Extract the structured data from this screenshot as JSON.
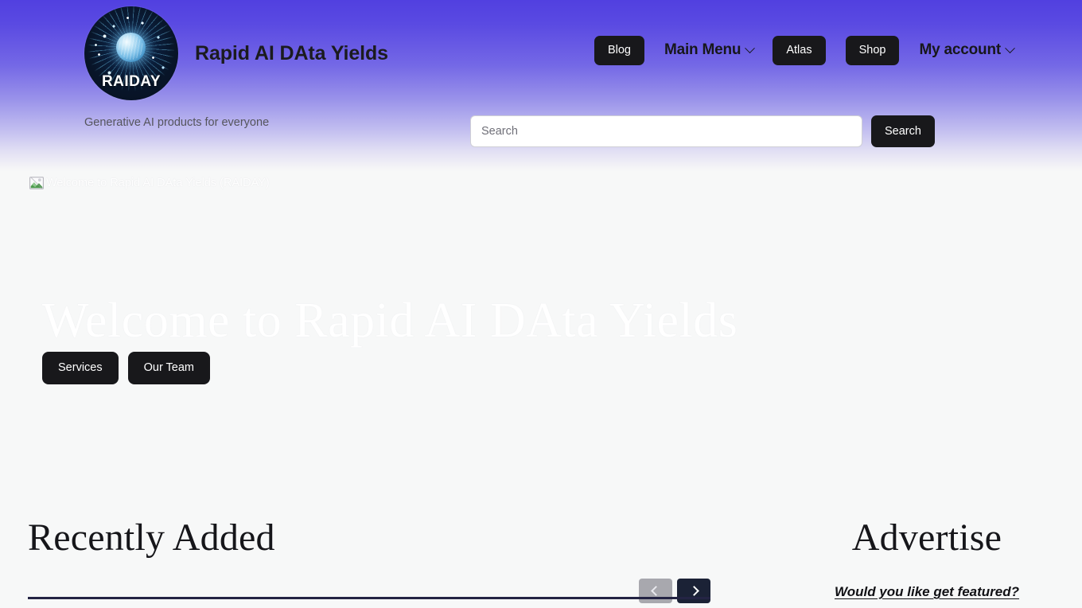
{
  "site": {
    "title": "Rapid AI DAta Yields",
    "logo_word": "RAIDAY",
    "logo_icon": "raiday-circular-emblem-icon",
    "tagline": "Generative AI products for everyone"
  },
  "nav": {
    "items": [
      {
        "label": "Blog",
        "style": "button",
        "has_chevron": false
      },
      {
        "label": "Main Menu",
        "style": "link",
        "has_chevron": true
      },
      {
        "label": "Atlas",
        "style": "button",
        "has_chevron": false
      },
      {
        "label": "Shop",
        "style": "button",
        "has_chevron": false
      },
      {
        "label": "My account",
        "style": "link",
        "has_chevron": true
      }
    ]
  },
  "search": {
    "value": "",
    "placeholder": "Search",
    "button_label": "Search",
    "icon": "search-icon"
  },
  "hero": {
    "image_alt": "Welcome to Rapid AI DAta Yields (RAIDAY)",
    "image_state": "broken",
    "broken_icon": "broken-image-icon",
    "title": "Welcome to Rapid AI DAta Yields",
    "buttons": [
      {
        "label": "Services"
      },
      {
        "label": "Our Team"
      }
    ]
  },
  "recently_added": {
    "title": "Recently Added",
    "carousel": {
      "prev_icon": "chevron-left-icon",
      "prev_label": "‹",
      "prev_disabled": true,
      "next_icon": "chevron-right-icon",
      "next_label": "›",
      "next_disabled": false
    }
  },
  "advertise": {
    "title": "Advertise",
    "cta_label": "Would you like get featured?"
  },
  "colors": {
    "gradient_top": "#5140e0",
    "gradient_mid": "#8c83e8",
    "page_bg": "#f7f8f8",
    "button_dark": "#18181b",
    "rule_navy": "#242444",
    "carousel_next": "#1b2236",
    "carousel_prev": "#a8a8ae"
  }
}
